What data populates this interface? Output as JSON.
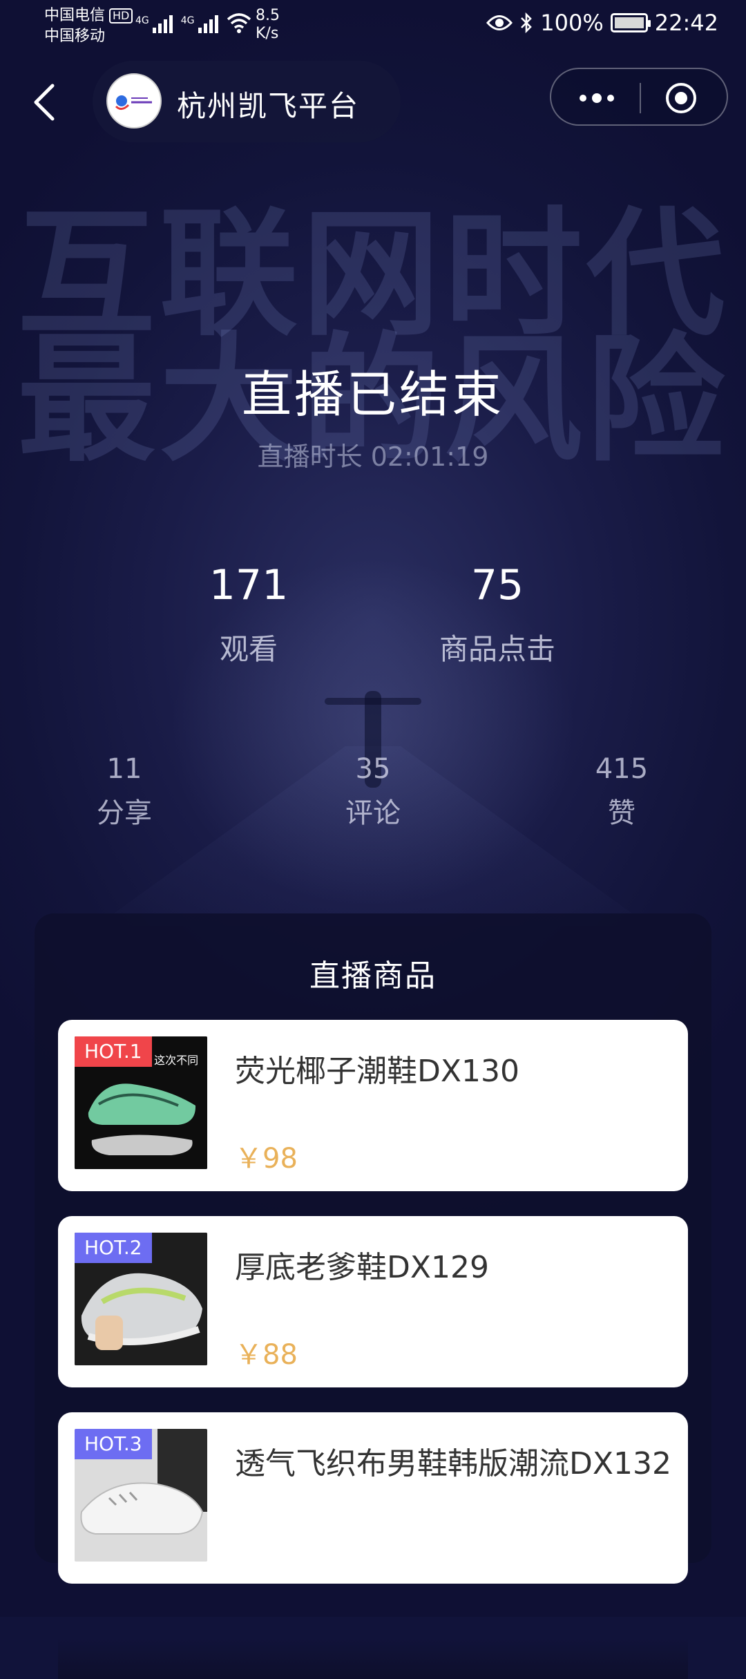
{
  "status_bar": {
    "carrier1": "中国电信",
    "hd_badge": "HD",
    "carrier2": "中国移动",
    "signal_labels": [
      "4G",
      "4G"
    ],
    "net_speed_value": "8.5",
    "net_speed_unit": "K/s",
    "battery": "100%",
    "time": "22:42"
  },
  "nav": {
    "title": "杭州凯飞平台"
  },
  "live": {
    "ended_title": "直播已结束",
    "duration_label": "直播时长 02:01:19"
  },
  "stats": {
    "views": {
      "value": "171",
      "label": "观看"
    },
    "product_clicks": {
      "value": "75",
      "label": "商品点击"
    },
    "shares": {
      "value": "11",
      "label": "分享"
    },
    "comments": {
      "value": "35",
      "label": "评论"
    },
    "likes": {
      "value": "415",
      "label": "赞"
    }
  },
  "products": {
    "section_title": "直播商品",
    "items": [
      {
        "badge": "HOT.1",
        "badge_color": "#f0454a",
        "name": "荧光椰子潮鞋DX130",
        "price": "￥98",
        "thumb_text": "鞋 这次不同"
      },
      {
        "badge": "HOT.2",
        "badge_color": "#6d6df2",
        "name": "厚底老爹鞋DX129",
        "price": "￥88"
      },
      {
        "badge": "HOT.3",
        "badge_color": "#6d6df2",
        "name": "透气飞织布男鞋韩版潮流DX132",
        "price": ""
      }
    ]
  },
  "poster": {
    "line1": "互联网时代",
    "line2": "最大的风险"
  },
  "colors": {
    "background": "#11133a",
    "price": "#e9b159",
    "hot_red": "#f0454a",
    "hot_purple": "#6d6df2"
  }
}
